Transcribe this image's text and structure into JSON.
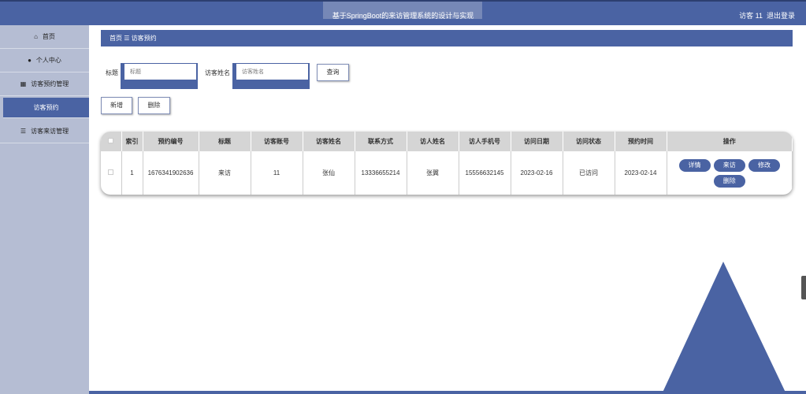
{
  "header": {
    "title": "基于SpringBoot的来访管理系统的设计与实现",
    "user": "访客 11",
    "logout": "退出登录"
  },
  "sidebar": {
    "items": [
      {
        "label": "首页",
        "icon": "home-icon"
      },
      {
        "label": "个人中心",
        "icon": "user-icon"
      },
      {
        "label": "访客预约管理",
        "icon": "grid-icon"
      },
      {
        "label": "访客预约"
      },
      {
        "label": "访客来访管理",
        "icon": "list-icon"
      }
    ]
  },
  "breadcrumb": {
    "home": "首页",
    "sep": "☰",
    "current": "访客预约"
  },
  "search": {
    "title_label": "标题",
    "title_placeholder": "标题",
    "name_label": "访客姓名",
    "name_placeholder": "访客姓名",
    "query": "查询"
  },
  "actions": {
    "add": "新增",
    "delete": "删除"
  },
  "table": {
    "headers": [
      "索引",
      "预约编号",
      "标题",
      "访客账号",
      "访客姓名",
      "联系方式",
      "访人姓名",
      "访人手机号",
      "访问日期",
      "访问状态",
      "预约时间",
      "操作"
    ],
    "rows": [
      {
        "cells": [
          "1",
          "1676341902636",
          "来访",
          "11",
          "张仙",
          "13336655214",
          "张翼",
          "15556632145",
          "2023-02-16",
          "已访问",
          "2023-02-14"
        ],
        "ops": [
          "详情",
          "来访",
          "修改",
          "删除"
        ]
      }
    ]
  },
  "colors": {
    "primary": "#4a63a3",
    "sidebar": "#b5bdd3"
  }
}
